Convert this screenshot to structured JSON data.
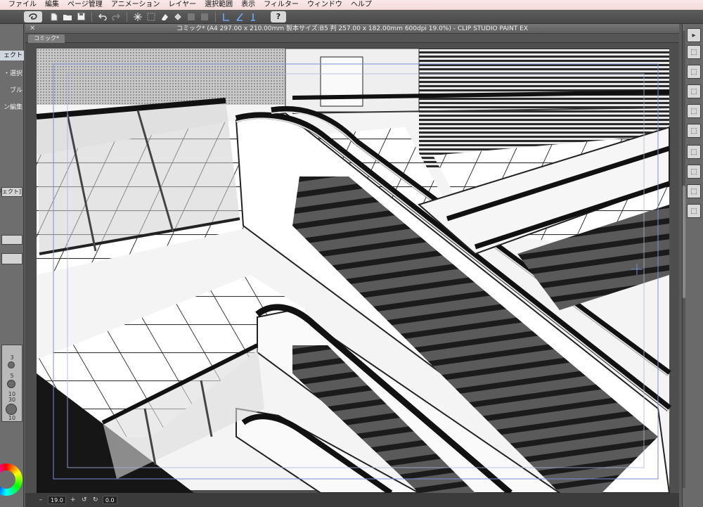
{
  "menubar": {
    "items": [
      "ファイル",
      "編集",
      "ページ管理",
      "アニメーション",
      "レイヤー",
      "選択範囲",
      "表示",
      "フィルター",
      "ウィンドウ",
      "ヘルプ"
    ]
  },
  "toolbar": {
    "icons": [
      "new-file-icon",
      "open-folder-icon",
      "save-icon",
      "undo-icon",
      "redo-icon",
      "transform-icon",
      "clear-icon",
      "fill-icon",
      "snap-ruler-icon",
      "snap-special-ruler-icon",
      "snap-grid-icon",
      "help-icon"
    ],
    "help_label": "?"
  },
  "document": {
    "title": "コミック* (A4 297.00 x 210.00mm 製本サイズ:B5 判 257.00 x 182.00mm 600dpi 19.0%) - CLIP STUDIO PAINT EX",
    "tab_label": "コミック*"
  },
  "left_panel": {
    "labels": [
      "ェクト",
      "・選択",
      "ブル",
      "ン編集",
      "ジェクト]"
    ],
    "brush_sizes": [
      "3",
      "5",
      "10",
      "30",
      "10"
    ]
  },
  "statusbar": {
    "zoom": "19.0",
    "rotation": "0.0"
  },
  "colors": {
    "menubar_bg": "#f3d9da",
    "ui_dark": "#4a4a4a",
    "ui_panel": "#6e6e6e",
    "selection_tab": "#cfd6dd"
  }
}
